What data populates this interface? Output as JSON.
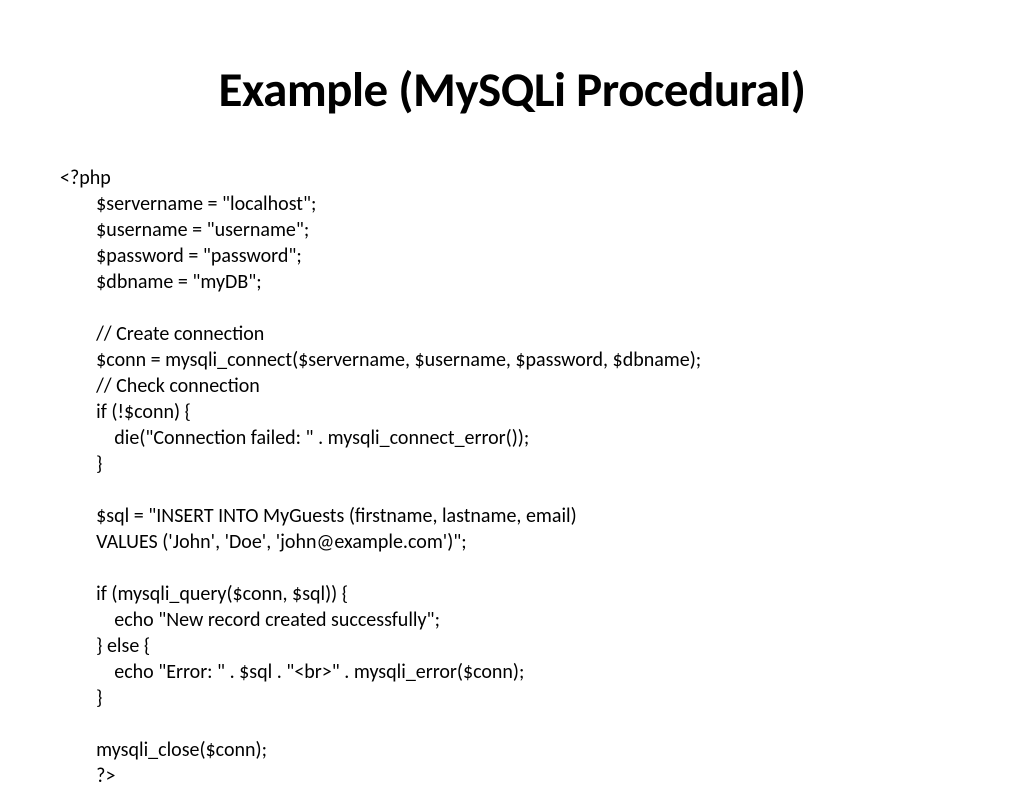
{
  "slide": {
    "title": "Example (MySQLi Procedural)",
    "code": "<?php\n        $servername = \"localhost\";\n        $username = \"username\";\n        $password = \"password\";\n        $dbname = \"myDB\";\n\n        // Create connection\n        $conn = mysqli_connect($servername, $username, $password, $dbname);\n        // Check connection\n        if (!$conn) {\n            die(\"Connection failed: \" . mysqli_connect_error());\n        }\n\n        $sql = \"INSERT INTO MyGuests (firstname, lastname, email)\n        VALUES ('John', 'Doe', 'john@example.com')\";\n\n        if (mysqli_query($conn, $sql)) {\n            echo \"New record created successfully\";\n        } else {\n            echo \"Error: \" . $sql . \"<br>\" . mysqli_error($conn);\n        }\n\n        mysqli_close($conn);\n        ?>"
  }
}
